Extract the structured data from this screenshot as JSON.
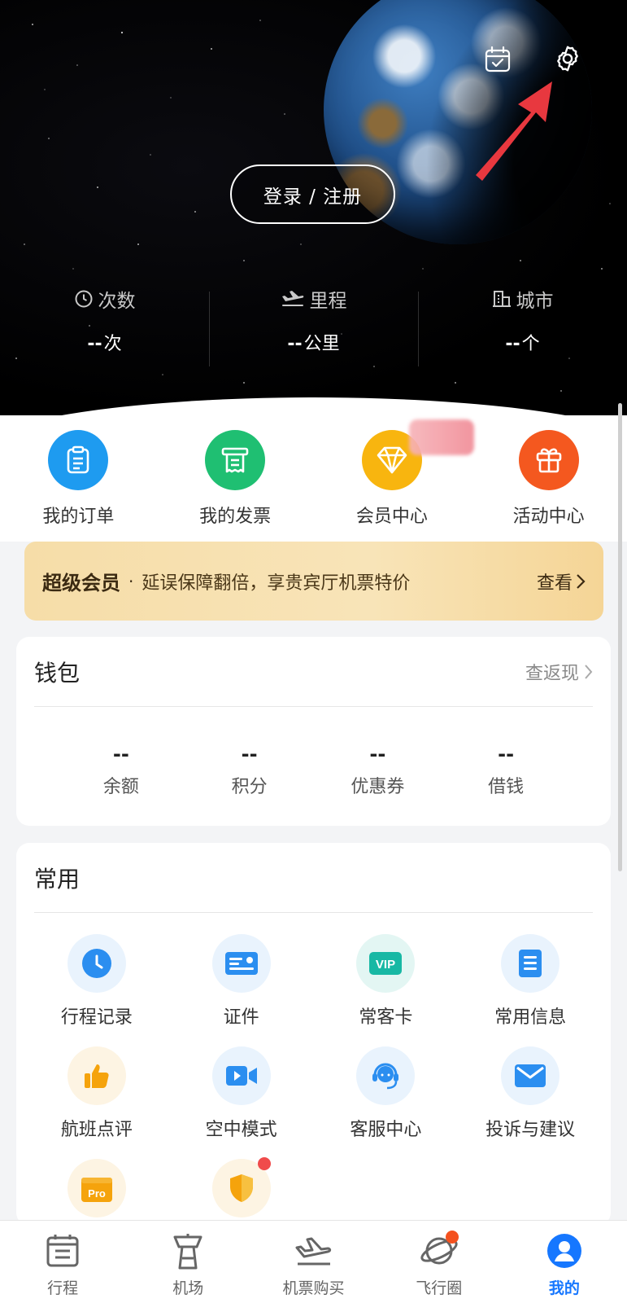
{
  "header": {
    "login_label": "登录 / 注册",
    "stats": [
      {
        "label": "次数",
        "value": "--",
        "unit": "次",
        "icon": "clock-icon"
      },
      {
        "label": "里程",
        "value": "--",
        "unit": "公里",
        "icon": "plane-landing-icon"
      },
      {
        "label": "城市",
        "value": "--",
        "unit": "个",
        "icon": "building-icon"
      }
    ]
  },
  "quick": [
    {
      "label": "我的订单",
      "icon": "clipboard-icon",
      "color": "#1e9bf0"
    },
    {
      "label": "我的发票",
      "icon": "receipt-icon",
      "color": "#1fbf72"
    },
    {
      "label": "会员中心",
      "icon": "diamond-icon",
      "color": "#f8b50f"
    },
    {
      "label": "活动中心",
      "icon": "gift-icon",
      "color": "#f4581f"
    }
  ],
  "vip_banner": {
    "title": "超级会员",
    "dot": "·",
    "desc": "延误保障翻倍，享贵宾厅机票特价",
    "link": "查看"
  },
  "wallet": {
    "title": "钱包",
    "link": "查返现",
    "items": [
      {
        "value": "--",
        "label": "余额"
      },
      {
        "value": "--",
        "label": "积分"
      },
      {
        "value": "--",
        "label": "优惠券"
      },
      {
        "value": "--",
        "label": "借钱"
      }
    ]
  },
  "common": {
    "title": "常用",
    "items": [
      {
        "label": "行程记录",
        "icon": "clock-icon"
      },
      {
        "label": "证件",
        "icon": "id-card-icon"
      },
      {
        "label": "常客卡",
        "icon": "vip-card-icon",
        "vip_text": "VIP"
      },
      {
        "label": "常用信息",
        "icon": "document-icon"
      },
      {
        "label": "航班点评",
        "icon": "thumbs-up-icon"
      },
      {
        "label": "空中模式",
        "icon": "video-icon"
      },
      {
        "label": "客服中心",
        "icon": "headset-icon"
      },
      {
        "label": "投诉与建议",
        "icon": "mail-icon"
      },
      {
        "label": "",
        "icon": "pro-box-icon",
        "pro_text": "Pro"
      },
      {
        "label": "",
        "icon": "shield-icon"
      }
    ]
  },
  "tabs": [
    {
      "label": "行程",
      "icon": "itinerary-icon"
    },
    {
      "label": "机场",
      "icon": "airport-tower-icon"
    },
    {
      "label": "机票购买",
      "icon": "airplane-icon"
    },
    {
      "label": "飞行圈",
      "icon": "planet-icon"
    },
    {
      "label": "我的",
      "icon": "profile-icon"
    }
  ],
  "colors": {
    "accent_blue": "#1677ff",
    "vip_gold": "#f6dda8",
    "arrow_red": "#e8383f"
  }
}
